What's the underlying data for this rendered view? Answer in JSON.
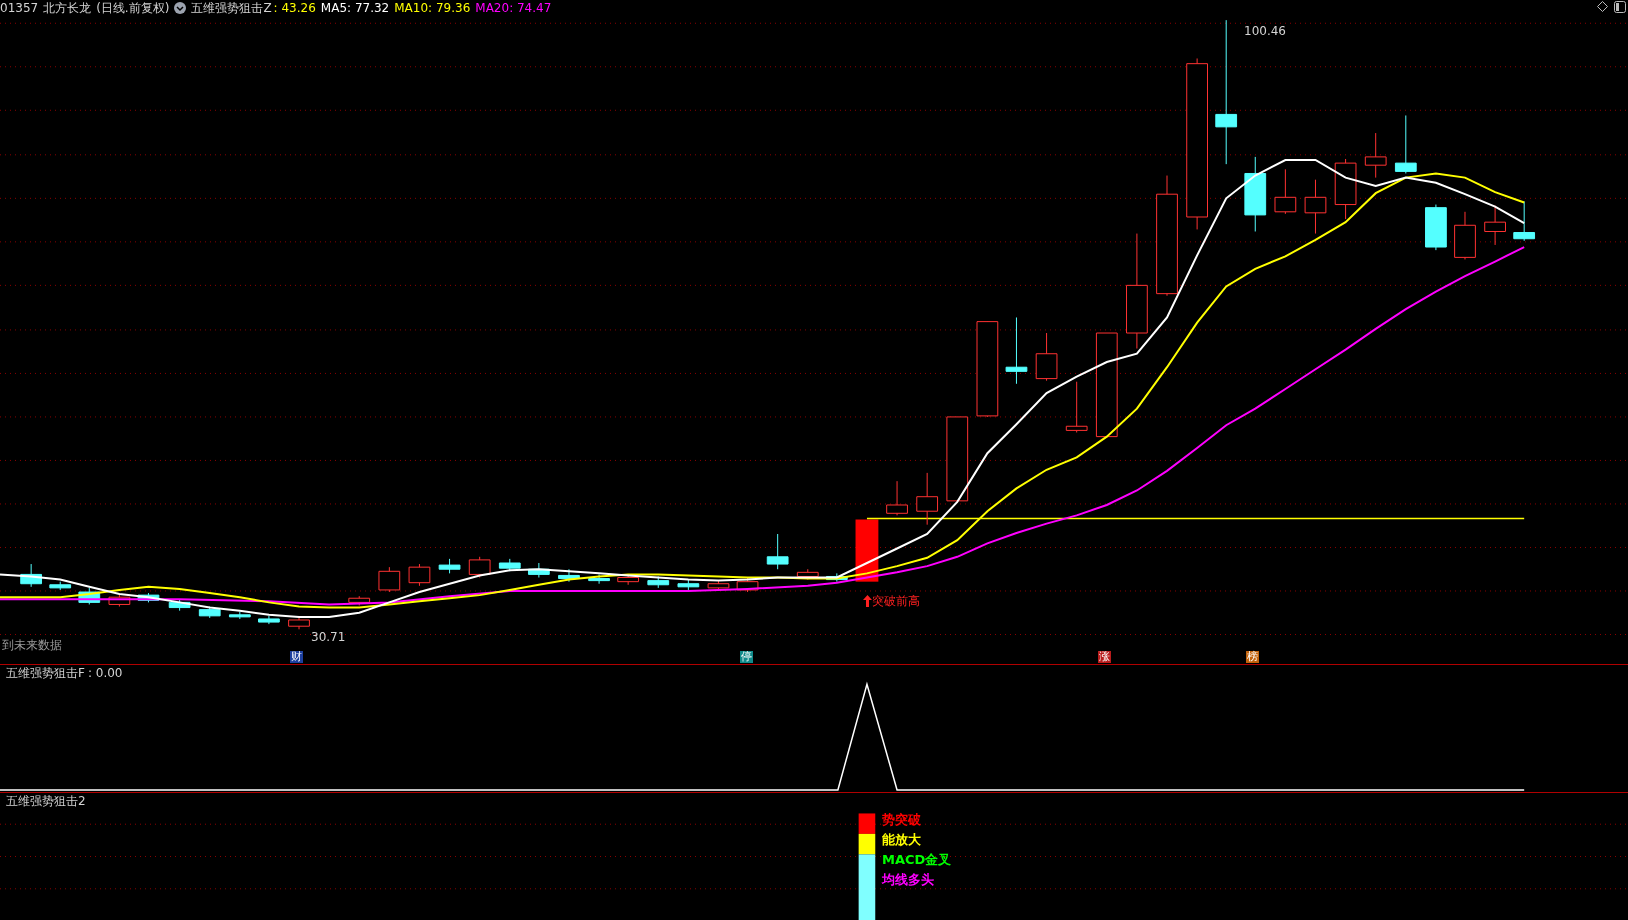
{
  "header": {
    "code": "01357",
    "name": "北方长龙",
    "period": "(日线.前复权)",
    "indicator": "五维强势狙击Z",
    "value": ": 43.26",
    "ma": [
      {
        "label": "MA5: 77.32",
        "color": "#ffffff"
      },
      {
        "label": "MA10: 79.36",
        "color": "#ffff00"
      },
      {
        "label": "MA20: 74.47",
        "color": "#ff00ff"
      }
    ]
  },
  "main_chart": {
    "high_label": "100.46",
    "low_label": "30.71",
    "signal_label": "突破前高",
    "future_label": "到未来数据"
  },
  "markers": [
    {
      "text": "财",
      "color": "#1d3f9e"
    },
    {
      "text": "停",
      "color": "#0f8a8a"
    },
    {
      "text": "涨",
      "color": "#b91c1c"
    },
    {
      "text": "榜",
      "color": "#c2620c"
    }
  ],
  "indicator_f": {
    "title": "五维强势狙击F",
    "value": ": 0.00"
  },
  "indicator_2": {
    "title": "五维强势狙击2",
    "legend": [
      {
        "text": "势突破",
        "color": "#ff0000"
      },
      {
        "text": "能放大",
        "color": "#ffff00"
      },
      {
        "text": "MACD金叉",
        "color": "#00ff00"
      },
      {
        "text": "均线多头",
        "color": "#ff00ff"
      }
    ]
  }
}
